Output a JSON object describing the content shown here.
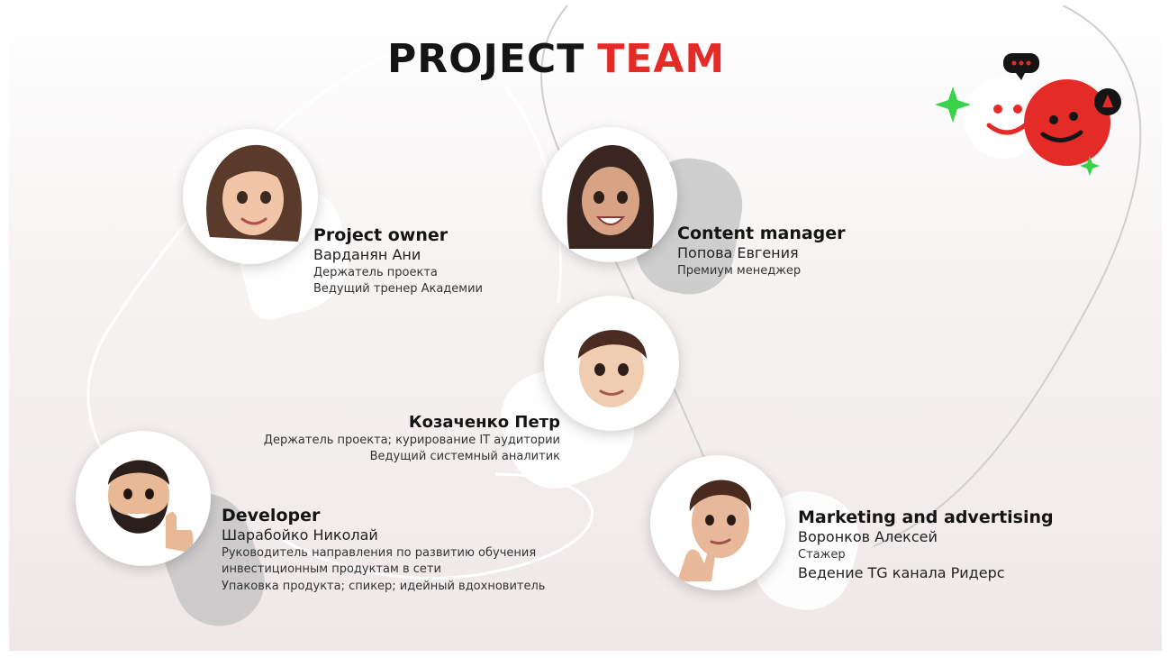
{
  "title": {
    "part1": "PROJECT",
    "part2": "TEAM"
  },
  "colors": {
    "accent": "#e52b28",
    "dark": "#151515",
    "green": "#39d24a"
  },
  "members": [
    {
      "role": "Project owner",
      "name": "Варданян Ани",
      "lines": [
        "Держатель проекта",
        "Ведущий тренер Академии"
      ]
    },
    {
      "role": "Content manager",
      "name": "Попова Евгения",
      "lines": [
        "Премиум менеджер"
      ]
    },
    {
      "role": "",
      "name": "Козаченко Петр",
      "lines": [
        "Держатель проекта; курирование IT аудитории",
        "Ведущий системный аналитик"
      ]
    },
    {
      "role": "Developer",
      "name": "Шарабойко Николай",
      "lines": [
        "Руководитель направления по развитию обучения",
        "инвестиционным продуктам в сети",
        "Упаковка продукта; спикер; идейный вдохновитель"
      ]
    },
    {
      "role": "Marketing and advertising",
      "name": "Воронков Алексей",
      "lines": [
        "Стажер",
        "Ведение TG канала Ридерс"
      ]
    }
  ],
  "icons": [
    "female-memoji-icon",
    "female-memoji-icon",
    "male-memoji-icon",
    "bearded-memoji-icon",
    "thinking-memoji-icon",
    "smiley-logo-icon",
    "chat-bubble-icon",
    "sparkle-icon"
  ]
}
